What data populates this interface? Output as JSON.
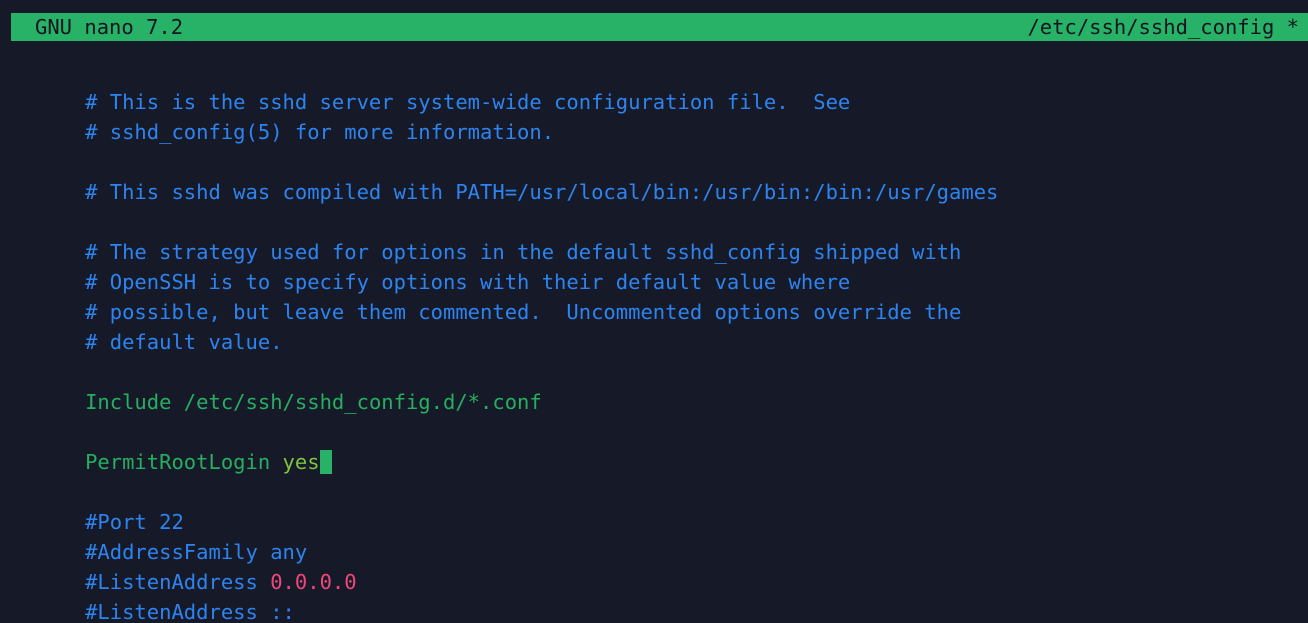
{
  "app": {
    "name": "GNU nano",
    "version": "7.2",
    "titlebar_left": "GNU nano 7.2",
    "titlebar_right": "/etc/ssh/sshd_config *",
    "filename": "/etc/ssh/sshd_config",
    "modified_marker": "*"
  },
  "colors": {
    "background": "#161a28",
    "titlebar_bg": "#27b267",
    "titlebar_fg": "#11151f",
    "comment": "#2d84f0",
    "keyword": "#27ae60",
    "value": "#7fc43f",
    "number": "#f0467a",
    "cursor": "#27b267",
    "default_text": "#d7dae3"
  },
  "buffer": {
    "lines": [
      {
        "n": 1,
        "kind": "comment",
        "text": "# This is the sshd server system-wide configuration file.  See"
      },
      {
        "n": 2,
        "kind": "comment",
        "text": "# sshd_config(5) for more information."
      },
      {
        "n": 3,
        "kind": "blank",
        "text": ""
      },
      {
        "n": 4,
        "kind": "comment",
        "text": "# This sshd was compiled with PATH=/usr/local/bin:/usr/bin:/bin:/usr/games"
      },
      {
        "n": 5,
        "kind": "blank",
        "text": ""
      },
      {
        "n": 6,
        "kind": "comment",
        "text": "# The strategy used for options in the default sshd_config shipped with"
      },
      {
        "n": 7,
        "kind": "comment",
        "text": "# OpenSSH is to specify options with their default value where"
      },
      {
        "n": 8,
        "kind": "comment",
        "text": "# possible, but leave them commented.  Uncommented options override the"
      },
      {
        "n": 9,
        "kind": "comment",
        "text": "# default value."
      },
      {
        "n": 10,
        "kind": "blank",
        "text": ""
      },
      {
        "n": 11,
        "kind": "directive-path",
        "keyword": "Include",
        "value": " /etc/ssh/sshd_config.d/*.conf",
        "text": "Include /etc/ssh/sshd_config.d/*.conf"
      },
      {
        "n": 12,
        "kind": "blank",
        "text": ""
      },
      {
        "n": 13,
        "kind": "directive-cursor",
        "keyword": "PermitRootLogin",
        "value": " yes",
        "text": "PermitRootLogin yes"
      },
      {
        "n": 14,
        "kind": "blank",
        "text": ""
      },
      {
        "n": 15,
        "kind": "comment",
        "text": "#Port 22"
      },
      {
        "n": 16,
        "kind": "comment",
        "text": "#AddressFamily any"
      },
      {
        "n": 17,
        "kind": "comment-number",
        "prefix": "#ListenAddress ",
        "number": "0.0.0.0",
        "text": "#ListenAddress 0.0.0.0"
      },
      {
        "n": 18,
        "kind": "comment",
        "text": "#ListenAddress ::"
      }
    ]
  }
}
